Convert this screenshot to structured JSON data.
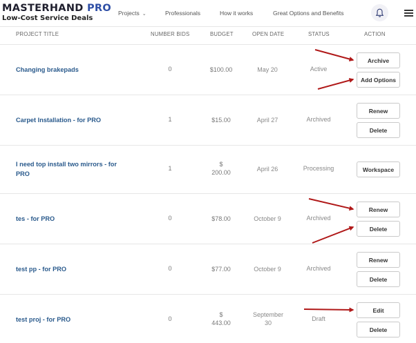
{
  "header": {
    "brand_name": "MASTERHAND",
    "brand_pro": "PRO",
    "tagline": "Low-Cost Service Deals",
    "nav": [
      "Projects",
      "Professionals",
      "How it works",
      "Great Options and Benefits"
    ]
  },
  "table": {
    "columns": [
      "PROJECT TITLE",
      "NUMBER BIDS",
      "BUDGET",
      "OPEN DATE",
      "STATUS",
      "ACTION"
    ],
    "rows": [
      {
        "title": "Changing brakepads",
        "bids": "0",
        "budget": "$100.00",
        "open": "May 20",
        "status": "Active",
        "actions": [
          "Archive",
          "Add Options"
        ]
      },
      {
        "title": "Carpet Installation - for PRO",
        "bids": "1",
        "budget": "$15.00",
        "open": "April 27",
        "status": "Archived",
        "actions": [
          "Renew",
          "Delete"
        ]
      },
      {
        "title": "I need top install two mirrors - for PRO",
        "bids": "1",
        "budget": "$ 200.00",
        "open": "April 26",
        "status": "Processing",
        "actions": [
          "Workspace"
        ]
      },
      {
        "title": "tes - for PRO",
        "bids": "0",
        "budget": "$78.00",
        "open": "October 9",
        "status": "Archived",
        "actions": [
          "Renew",
          "Delete"
        ]
      },
      {
        "title": "test pp - for PRO",
        "bids": "0",
        "budget": "$77.00",
        "open": "October 9",
        "status": "Archived",
        "actions": [
          "Renew",
          "Delete"
        ]
      },
      {
        "title": "test proj - for PRO",
        "bids": "0",
        "budget": "$ 443.00",
        "open": "September 30",
        "status": "Draft",
        "actions": [
          "Edit",
          "Delete"
        ]
      }
    ]
  },
  "colors": {
    "accent_link": "#2a5a8c",
    "arrow": "#b01818",
    "brand_pro": "#2f4fa6"
  },
  "icons": [
    "bell-icon",
    "menu-icon",
    "chevron-down-icon"
  ]
}
